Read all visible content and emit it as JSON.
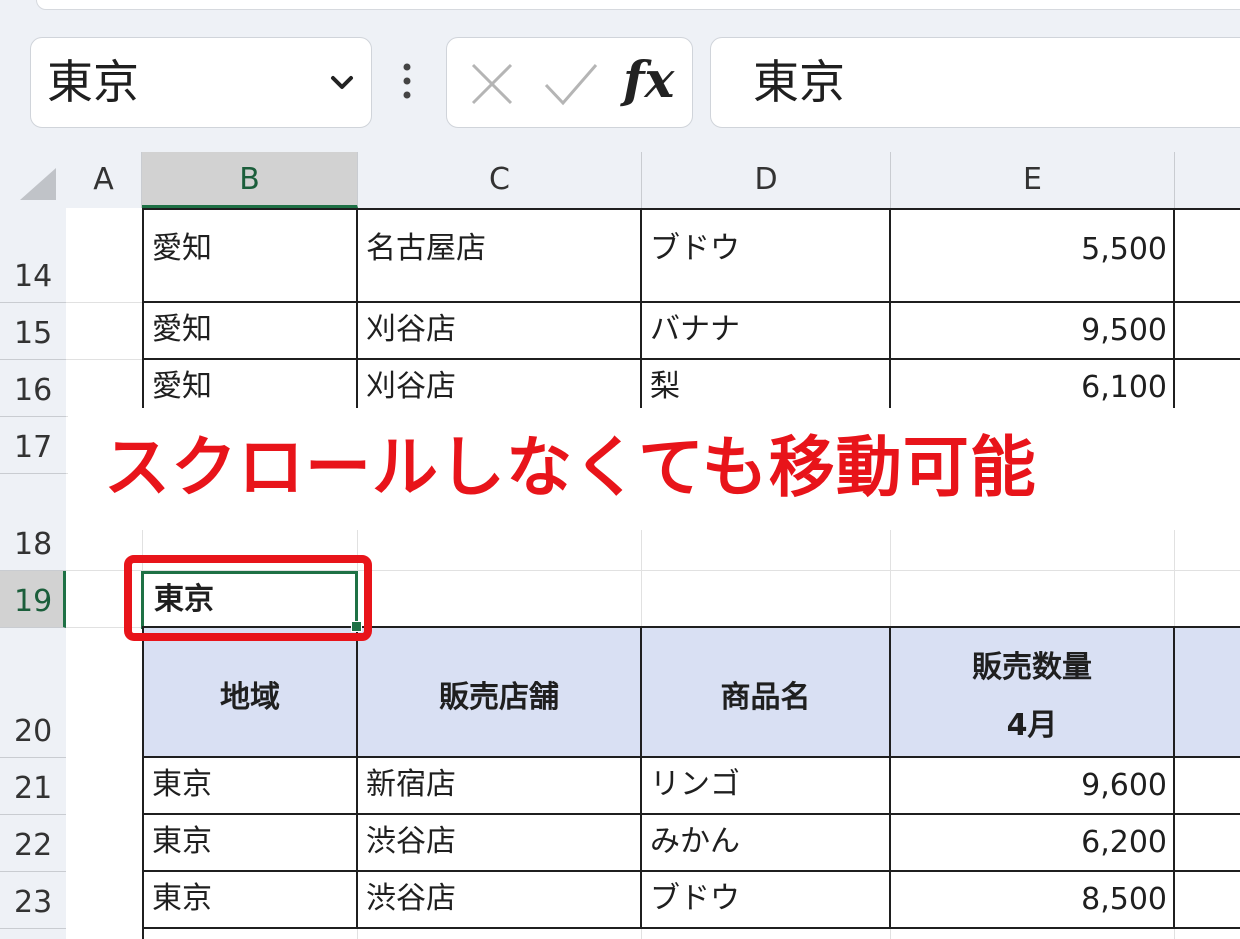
{
  "name_box": {
    "value": "東京"
  },
  "formula_bar": {
    "cancel_icon": "close-icon",
    "enter_icon": "check-icon",
    "fx_label": "fx",
    "value": "東京"
  },
  "columns": [
    "A",
    "B",
    "C",
    "D",
    "E"
  ],
  "rows": {
    "r14": {
      "num": "14",
      "cells": [
        "愛知",
        "名古屋店",
        "ブドウ",
        "5,500"
      ]
    },
    "r15": {
      "num": "15",
      "cells": [
        "愛知",
        "刈谷店",
        "バナナ",
        "9,500"
      ]
    },
    "r16": {
      "num": "16",
      "cells": [
        "愛知",
        "刈谷店",
        "梨",
        "6,100"
      ]
    },
    "r17": {
      "num": "17"
    },
    "r18": {
      "num": "18"
    },
    "r19": {
      "num": "19",
      "active_value": "東京"
    },
    "r20": {
      "num": "20",
      "headers": [
        "地域",
        "販売店舗",
        "商品名",
        "販売数量",
        "4月"
      ]
    },
    "r21": {
      "num": "21",
      "cells": [
        "東京",
        "新宿店",
        "リンゴ",
        "9,600"
      ]
    },
    "r22": {
      "num": "22",
      "cells": [
        "東京",
        "渋谷店",
        "みかん",
        "6,200"
      ]
    },
    "r23": {
      "num": "23",
      "cells": [
        "東京",
        "渋谷店",
        "ブドウ",
        "8,500"
      ]
    }
  },
  "annotation": {
    "text": "スクロールしなくても移動可能",
    "color": "#e8141a"
  },
  "colors": {
    "accent_green": "#1e7145",
    "header_fill": "#d9e0f3",
    "annotation_red": "#e8141a"
  }
}
